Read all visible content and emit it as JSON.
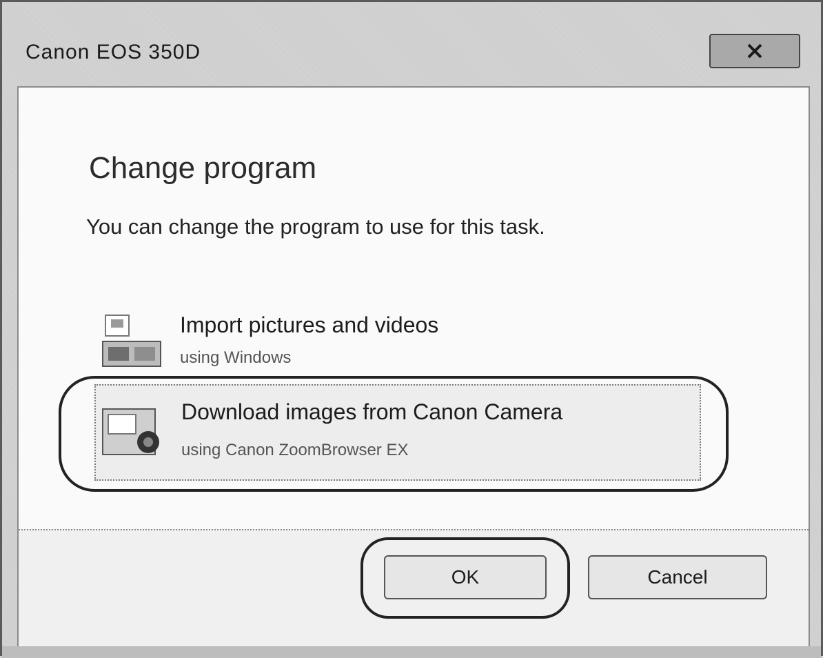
{
  "window": {
    "title": "Canon EOS 350D",
    "close_icon": "close-icon"
  },
  "dialog": {
    "heading": "Change program",
    "description": "You can change the program to use for this task."
  },
  "options": [
    {
      "title": "Import pictures and videos",
      "subtitle": "using Windows",
      "icon": "windows-import-icon"
    },
    {
      "title": "Download images from Canon Camera",
      "subtitle": "using Canon ZoomBrowser EX",
      "icon": "camera-download-icon"
    }
  ],
  "buttons": {
    "ok": "OK",
    "cancel": "Cancel"
  },
  "colors": {
    "highlight_ring": "#222222",
    "client_bg": "#fafafa"
  }
}
